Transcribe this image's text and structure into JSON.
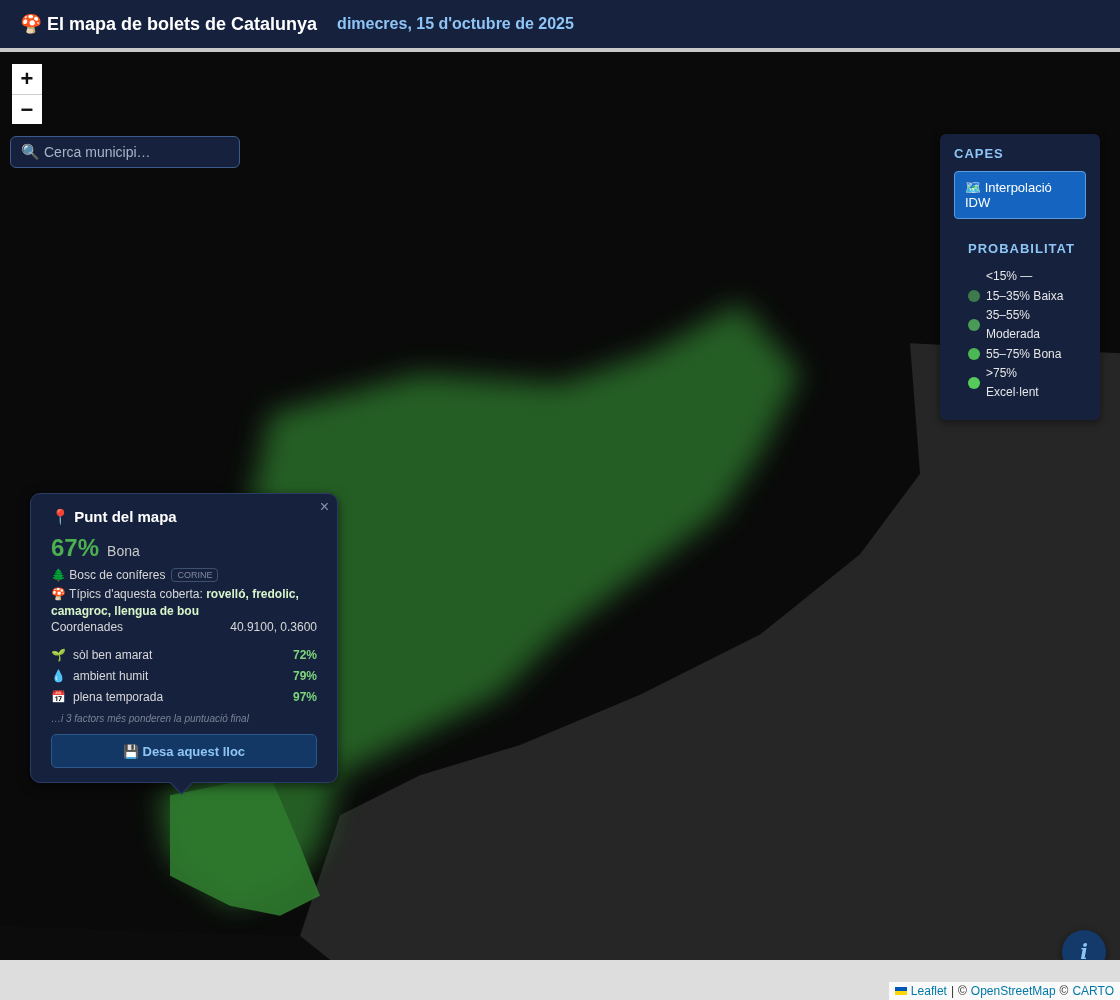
{
  "header": {
    "logo": "🍄",
    "title": "El mapa de bolets de Catalunya",
    "date": "dimecres, 15 d'octubre de 2025"
  },
  "zoom_controls": [
    "+",
    "−"
  ],
  "search": {
    "icon": "🔍",
    "placeholder": "Cerca municipi…"
  },
  "layers_panel": {
    "title": "CAPES",
    "layers": [
      {
        "icon": "🗺️",
        "label": "Interpolació IDW",
        "selected": true
      }
    ],
    "legend_title": "PROBABILITAT",
    "legend": [
      {
        "label": "<15% —"
      },
      {
        "label": "15–35% Baixa",
        "color": "#3e7a4c"
      },
      {
        "label": "35–55% Moderada",
        "color": "#4a9a58"
      },
      {
        "label": "55–75% Bona",
        "color": "#4cb854"
      },
      {
        "label": ">75% Excel·lent",
        "color": "#55cc5a"
      }
    ]
  },
  "popup": {
    "icon": "📍",
    "title": "Punt del mapa",
    "close": "×",
    "score": "67%",
    "rating": "Bona",
    "cover": {
      "icon": "🌲",
      "label": "Bosc de coníferes",
      "tag": "CORINE"
    },
    "typical": "🍄 Típics d'aquesta coberta: **rovelló, fredolic, camagroc, llengua de bou**",
    "coordinates_label": "Coordenades",
    "coordinates": "40.9100, 0.3600",
    "factors": [
      {
        "icon": "🌱",
        "label": "sòl ben amarat",
        "value": "72%"
      },
      {
        "icon": "💧",
        "label": "ambient humit",
        "value": "79%"
      },
      {
        "icon": "📅",
        "label": "plena temporada",
        "value": "97%"
      }
    ],
    "note": "…i 3 factors més ponderen la puntuació final",
    "save_button": "💾 Desa aquest lloc"
  },
  "info_button": "i",
  "attribution": [
    {
      "kind": "link",
      "text": "Leaflet",
      "flag": true
    },
    {
      "kind": "text",
      "text": "|"
    },
    {
      "kind": "text",
      "text": "©"
    },
    {
      "kind": "link",
      "text": "OpenStreetMap"
    },
    {
      "kind": "text",
      "text": "©"
    },
    {
      "kind": "link",
      "text": "CARTO"
    }
  ]
}
